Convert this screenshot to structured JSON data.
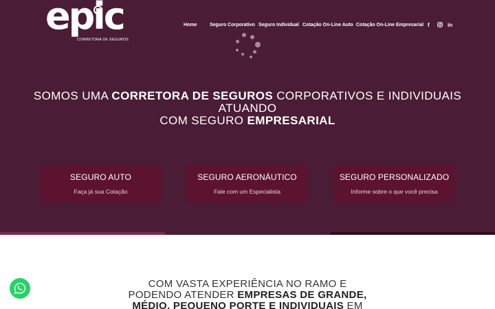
{
  "logo": {
    "word": "epic",
    "subtitle": "CORRETORA DE SEGUROS"
  },
  "nav": {
    "items": [
      {
        "label": "Home"
      },
      {
        "label": "Seguro Corporativo"
      },
      {
        "label": "Seguro Individual"
      },
      {
        "label": "Cotação On-Line Auto"
      },
      {
        "label": "Cotação On-Line Empresarial"
      }
    ]
  },
  "social": {
    "facebook": "f",
    "instagram": "instagram-icon",
    "linkedin": "in"
  },
  "hero": {
    "line1_a": "SOMOS UMA ",
    "line1_b": "CORRETORA DE SEGUROS",
    "line1_c": " CORPORATIVOS E INDIVIDUAIS",
    "line2": "ATUANDO",
    "line3_a": "COM SEGURO ",
    "line3_b": "EMPRESARIAL"
  },
  "cards": [
    {
      "title": "SEGURO AUTO",
      "subtitle": "Faça já sua Cotação"
    },
    {
      "title": "SEGURO AERONÁUTICO",
      "subtitle": "Fale com um Especialista"
    },
    {
      "title": "SEGURO PERSONALIZADO",
      "subtitle": "Informe sobre o que você precisa"
    }
  ],
  "section": {
    "line1": "COM VASTA EXPERIÊNCIA NO RAMO E",
    "line2_a": "PODENDO ATENDER ",
    "line2_b": "EMPRESAS DE GRANDE,",
    "line3_b": "MÉDIO, PEQUENO PORTE E INDIVIDUAIS",
    "line3_c": " EM"
  },
  "colors": {
    "hero_bg": "#4a1c36",
    "card_bg": "#5c1330",
    "whatsapp": "#25d366"
  }
}
